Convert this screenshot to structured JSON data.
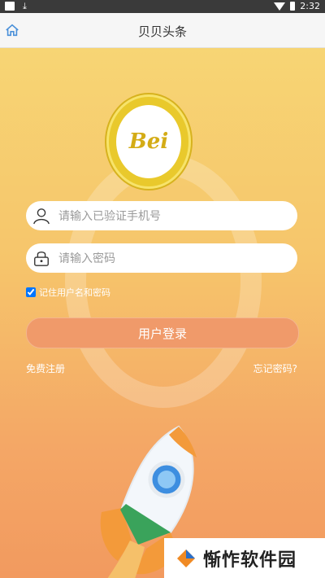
{
  "status_bar": {
    "time": "2:32",
    "download_glyph": "⤓"
  },
  "header": {
    "title": "贝贝头条",
    "home_icon": "home-icon"
  },
  "logo": {
    "text": "Bei"
  },
  "form": {
    "phone_placeholder": "请输入已验证手机号",
    "password_placeholder": "请输入密码",
    "remember_label": "记住用户名和密码",
    "remember_checked": true,
    "login_label": "用户登录",
    "register_label": "免费注册",
    "forgot_label": "忘记密码?"
  },
  "watermark": {
    "text": "惭怍软件园"
  },
  "colors": {
    "accent": "#f09a6a",
    "logo_gold": "#e9c92c",
    "background_top": "#f7d574",
    "background_bottom": "#f29a5f"
  }
}
